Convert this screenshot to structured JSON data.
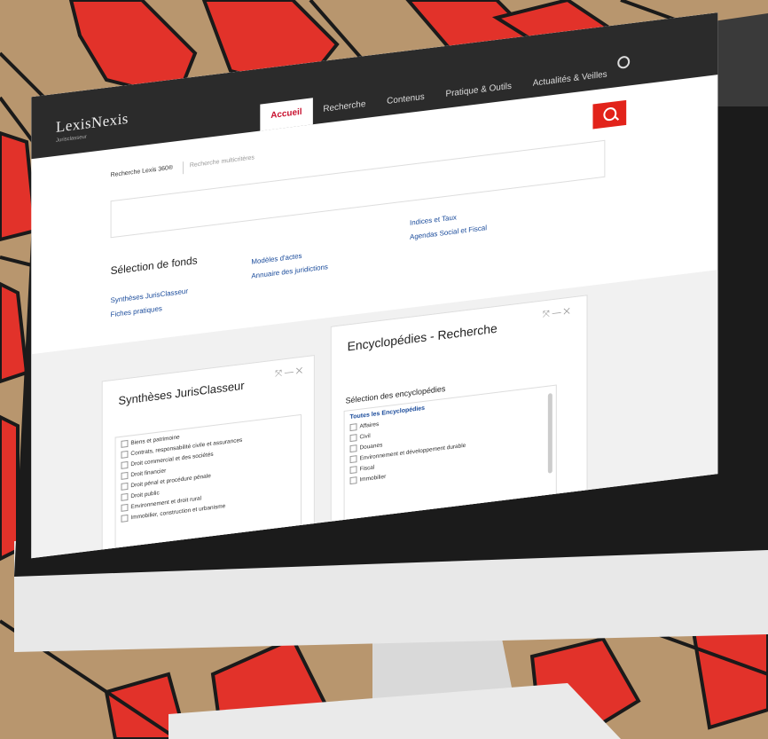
{
  "colors": {
    "accent": "#e2231a",
    "link": "#1a4b9b",
    "nav_bg": "#2b2b2b"
  },
  "header": {
    "logo": "LexisNexis",
    "logo_sub": "Jurisclasseur",
    "nav": [
      "Accueil",
      "Recherche",
      "Contenus",
      "Pratique & Outils",
      "Actualités & Veilles"
    ]
  },
  "search": {
    "scope": "Recherche Lexis 360®",
    "placeholder": "Recherche multicritères",
    "button_icon": "search-icon"
  },
  "funds": {
    "title": "Sélection de fonds",
    "links": [
      "Synthèses JurisClasseur",
      "Fiches pratiques",
      "Modèles d'actes",
      "Annuaire des juridictions",
      "Indices et Taux",
      "Agendas Social et Fiscal"
    ]
  },
  "panel1": {
    "title": "Synthèses JurisClasseur",
    "tools": "⤧ — ✕",
    "items": [
      "Biens et patrimoine",
      "Contrats, responsabilité civile et assurances",
      "Droit commercial et des sociétés",
      "Droit financier",
      "Droit pénal et procédure pénale",
      "Droit public",
      "Environnement et droit rural",
      "Immobilier, construction et urbanisme"
    ]
  },
  "panel2": {
    "title": "Encyclopédies - Recherche",
    "tools": "⤧ — ✕",
    "label": "Sélection des encyclopédies",
    "all": "Toutes les Encyclopédies",
    "items": [
      "Affaires",
      "Civil",
      "Douanes",
      "Environnement et développement durable",
      "Fiscal",
      "Immobilier"
    ]
  }
}
